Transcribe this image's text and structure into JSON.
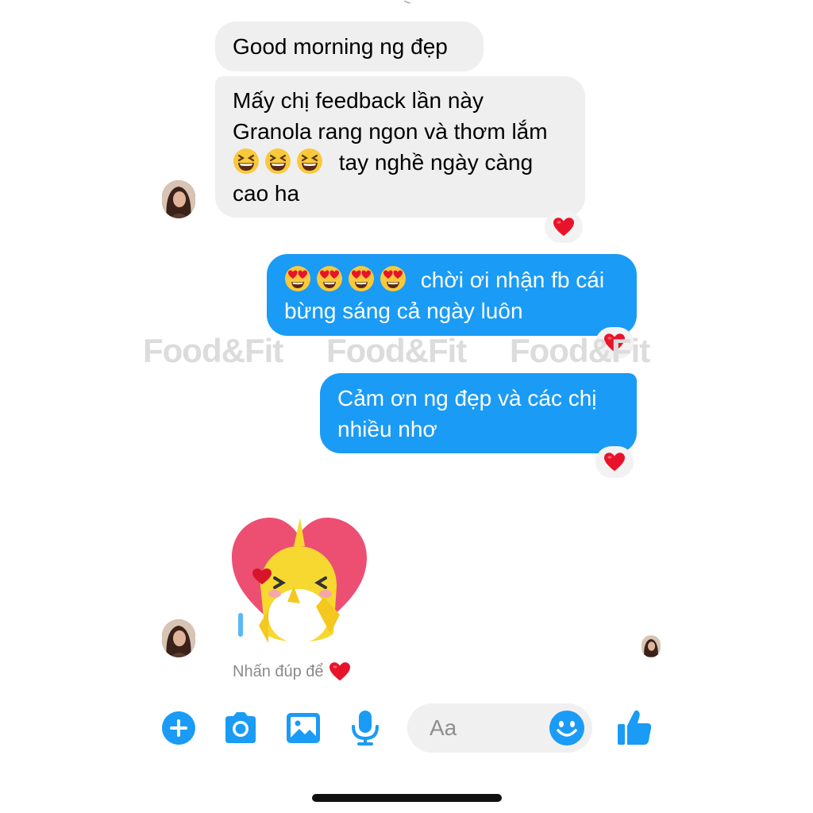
{
  "incoming": {
    "msg1": "Good morning ng đẹp",
    "msg2": {
      "line1": "Mấy chị feedback lần này",
      "line2": "Granola rang ngon và thơm lắm",
      "line3": "tay nghề ngày càng",
      "line4": "cao ha"
    },
    "msg2_emoji": "grinning-squinting-face-emoji x3",
    "msg2_reaction": "heart"
  },
  "outgoing": {
    "msg1": {
      "line1": "chời ơi nhận fb cái",
      "line2": "bừng sáng cả ngày luôn"
    },
    "msg1_emoji": "heart-eyes-emoji x4",
    "msg1_reaction": "heart",
    "msg2": {
      "line1": "Cảm ơn ng đẹp và các chị",
      "line2": "nhiều nhơ"
    },
    "msg2_reaction": "heart"
  },
  "watermark": [
    "Food&Fit",
    "Food&Fit",
    "Food&Fit"
  ],
  "sticker": {
    "name": "yellow-dino-heart-sticker",
    "hint": "Nhấn đúp để"
  },
  "composer": {
    "placeholder": "Aa",
    "icons": [
      "plus-icon",
      "camera-icon",
      "image-icon",
      "microphone-icon",
      "emoji-icon",
      "thumbs-up-icon"
    ]
  },
  "colors": {
    "accent": "#1a9bf5",
    "incoming_bubble": "#efefef",
    "heart": "#e8132a"
  }
}
